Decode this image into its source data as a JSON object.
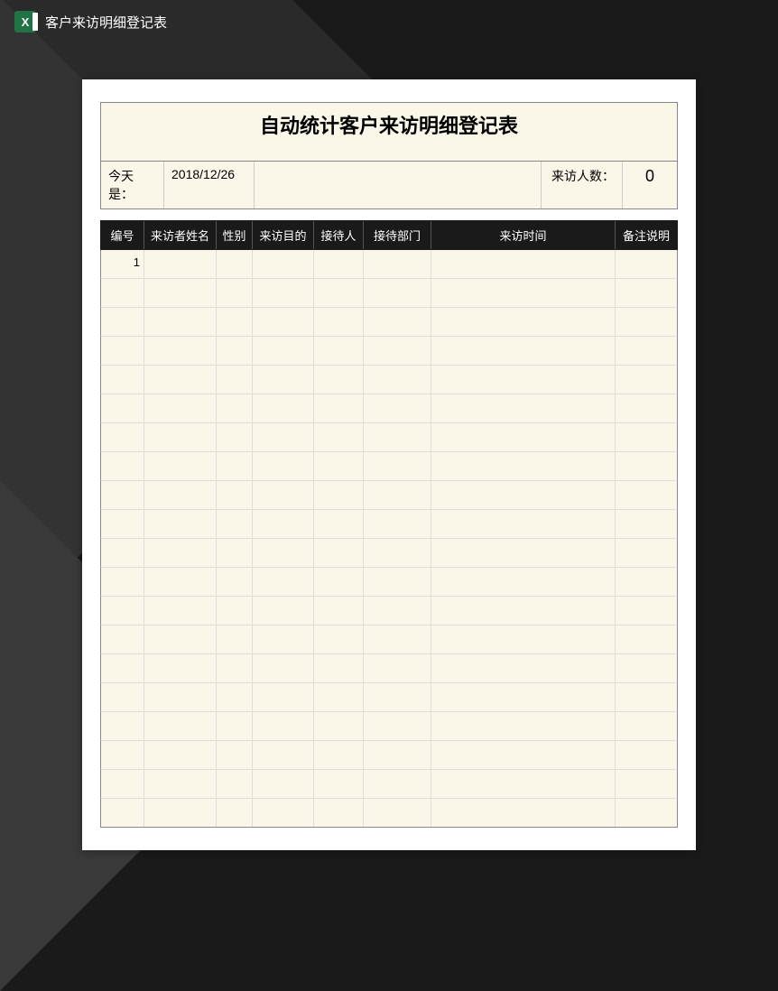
{
  "header": {
    "title": "客户来访明细登记表"
  },
  "document": {
    "title": "自动统计客户来访明细登记表",
    "today_label": "今天是：",
    "today_date": "2018/12/26",
    "visitor_count_label": "来访人数：",
    "visitor_count": "0",
    "columns": {
      "num": "编号",
      "name": "来访者姓名",
      "gender": "性别",
      "purpose": "来访目的",
      "receiver": "接待人",
      "dept": "接待部门",
      "time": "来访时间",
      "note": "备注说明"
    },
    "rows": [
      {
        "num": "1",
        "name": "",
        "gender": "",
        "purpose": "",
        "receiver": "",
        "dept": "",
        "time": "",
        "note": ""
      },
      {
        "num": "",
        "name": "",
        "gender": "",
        "purpose": "",
        "receiver": "",
        "dept": "",
        "time": "",
        "note": ""
      },
      {
        "num": "",
        "name": "",
        "gender": "",
        "purpose": "",
        "receiver": "",
        "dept": "",
        "time": "",
        "note": ""
      },
      {
        "num": "",
        "name": "",
        "gender": "",
        "purpose": "",
        "receiver": "",
        "dept": "",
        "time": "",
        "note": ""
      },
      {
        "num": "",
        "name": "",
        "gender": "",
        "purpose": "",
        "receiver": "",
        "dept": "",
        "time": "",
        "note": ""
      },
      {
        "num": "",
        "name": "",
        "gender": "",
        "purpose": "",
        "receiver": "",
        "dept": "",
        "time": "",
        "note": ""
      },
      {
        "num": "",
        "name": "",
        "gender": "",
        "purpose": "",
        "receiver": "",
        "dept": "",
        "time": "",
        "note": ""
      },
      {
        "num": "",
        "name": "",
        "gender": "",
        "purpose": "",
        "receiver": "",
        "dept": "",
        "time": "",
        "note": ""
      },
      {
        "num": "",
        "name": "",
        "gender": "",
        "purpose": "",
        "receiver": "",
        "dept": "",
        "time": "",
        "note": ""
      },
      {
        "num": "",
        "name": "",
        "gender": "",
        "purpose": "",
        "receiver": "",
        "dept": "",
        "time": "",
        "note": ""
      },
      {
        "num": "",
        "name": "",
        "gender": "",
        "purpose": "",
        "receiver": "",
        "dept": "",
        "time": "",
        "note": ""
      },
      {
        "num": "",
        "name": "",
        "gender": "",
        "purpose": "",
        "receiver": "",
        "dept": "",
        "time": "",
        "note": ""
      },
      {
        "num": "",
        "name": "",
        "gender": "",
        "purpose": "",
        "receiver": "",
        "dept": "",
        "time": "",
        "note": ""
      },
      {
        "num": "",
        "name": "",
        "gender": "",
        "purpose": "",
        "receiver": "",
        "dept": "",
        "time": "",
        "note": ""
      },
      {
        "num": "",
        "name": "",
        "gender": "",
        "purpose": "",
        "receiver": "",
        "dept": "",
        "time": "",
        "note": ""
      },
      {
        "num": "",
        "name": "",
        "gender": "",
        "purpose": "",
        "receiver": "",
        "dept": "",
        "time": "",
        "note": ""
      },
      {
        "num": "",
        "name": "",
        "gender": "",
        "purpose": "",
        "receiver": "",
        "dept": "",
        "time": "",
        "note": ""
      },
      {
        "num": "",
        "name": "",
        "gender": "",
        "purpose": "",
        "receiver": "",
        "dept": "",
        "time": "",
        "note": ""
      },
      {
        "num": "",
        "name": "",
        "gender": "",
        "purpose": "",
        "receiver": "",
        "dept": "",
        "time": "",
        "note": ""
      },
      {
        "num": "",
        "name": "",
        "gender": "",
        "purpose": "",
        "receiver": "",
        "dept": "",
        "time": "",
        "note": ""
      }
    ]
  }
}
